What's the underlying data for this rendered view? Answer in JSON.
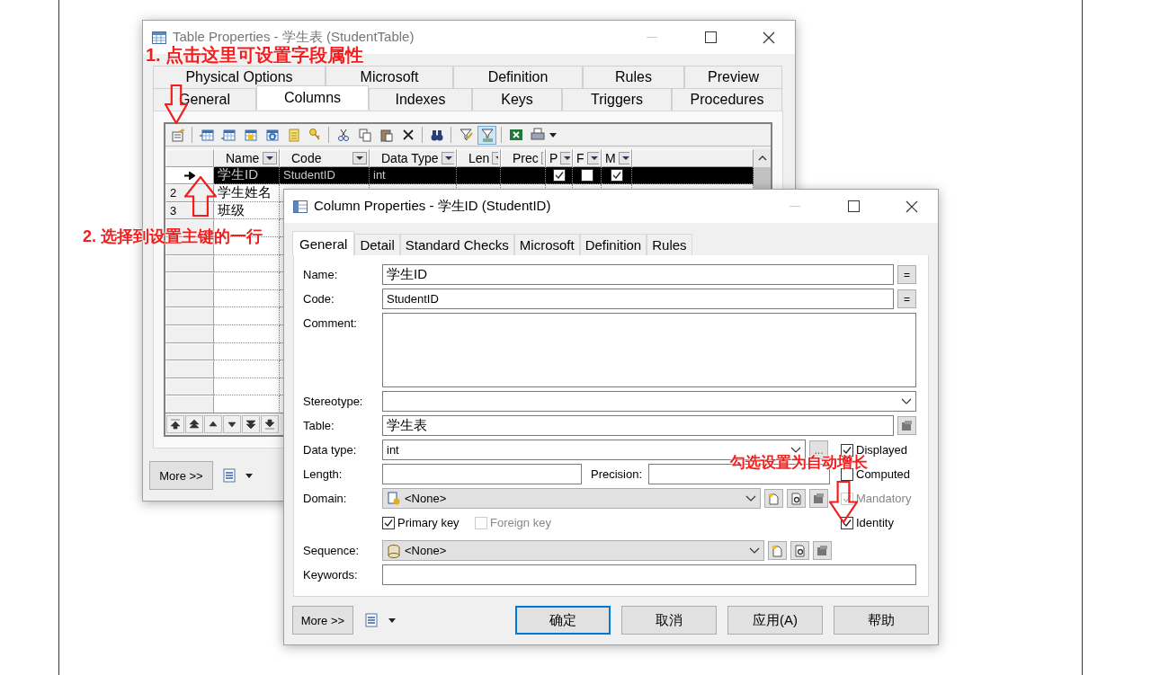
{
  "table_window": {
    "title": "Table Properties - 学生表 (StudentTable)",
    "tab_rows": [
      [
        {
          "label": "Physical Options",
          "selected": false
        },
        {
          "label": "Microsoft",
          "selected": false
        },
        {
          "label": "Definition",
          "selected": false
        },
        {
          "label": "Rules",
          "selected": false
        },
        {
          "label": "Preview",
          "selected": false
        }
      ],
      [
        {
          "label": "General",
          "selected": false
        },
        {
          "label": "Columns",
          "selected": true
        },
        {
          "label": "Indexes",
          "selected": false
        },
        {
          "label": "Keys",
          "selected": false
        },
        {
          "label": "Triggers",
          "selected": false
        },
        {
          "label": "Procedures",
          "selected": false
        }
      ]
    ],
    "grid": {
      "columns": [
        "Name",
        "Code",
        "Data Type",
        "Len",
        "Prec",
        "P",
        "F",
        "M"
      ],
      "rows": [
        {
          "current": true,
          "selected": true,
          "name": "学生ID",
          "code": "StudentID",
          "data_type": "int",
          "checks": [
            true,
            false,
            true
          ]
        },
        {
          "current": false,
          "selected": false,
          "number": "2",
          "name": "学生姓名"
        },
        {
          "current": false,
          "selected": false,
          "number": "3",
          "name": "班级"
        }
      ]
    },
    "more_button": "More >>"
  },
  "column_window": {
    "title": "Column Properties - 学生ID (StudentID)",
    "tabs": [
      {
        "label": "General",
        "selected": true
      },
      {
        "label": "Detail",
        "selected": false
      },
      {
        "label": "Standard Checks",
        "selected": false
      },
      {
        "label": "Microsoft",
        "selected": false
      },
      {
        "label": "Definition",
        "selected": false
      },
      {
        "label": "Rules",
        "selected": false
      }
    ],
    "form": {
      "name": {
        "label": "Name:",
        "value": "学生ID",
        "button": "="
      },
      "code": {
        "label": "Code:",
        "value": "StudentID",
        "button": "="
      },
      "comment": {
        "label": "Comment:"
      },
      "stereotype": {
        "label": "Stereotype:"
      },
      "table": {
        "label": "Table:",
        "value": "学生表"
      },
      "data_type": {
        "label": "Data type:",
        "value": "int",
        "button": "..."
      },
      "length": {
        "label": "Length:"
      },
      "precision": {
        "label": "Precision:"
      },
      "domain": {
        "label": "Domain:",
        "value": "<None>"
      },
      "sequence": {
        "label": "Sequence:",
        "value": "<None>"
      },
      "keywords": {
        "label": "Keywords:"
      },
      "side_checks": [
        {
          "label": "Displayed",
          "checked": true,
          "disabled": false
        },
        {
          "label": "Computed",
          "checked": false,
          "disabled": false
        },
        {
          "label": "Mandatory",
          "checked": true,
          "disabled": true
        },
        {
          "label": "Identity",
          "checked": true,
          "disabled": false
        }
      ],
      "key_checks": [
        {
          "label": "Primary key",
          "checked": true,
          "disabled": false
        },
        {
          "label": "Foreign key",
          "checked": false,
          "disabled": true
        }
      ]
    },
    "more_button": "More >>",
    "buttons": [
      {
        "label": "确定",
        "default": true
      },
      {
        "label": "取消",
        "default": false
      },
      {
        "label": "应用(A)",
        "default": false
      },
      {
        "label": "帮助",
        "default": false
      }
    ]
  },
  "annotations": [
    {
      "text": "1. 点击这里可设置字段属性"
    },
    {
      "text": "2. 选择到设置主键的一行"
    },
    {
      "text": "勾选设置为自动增长"
    }
  ]
}
